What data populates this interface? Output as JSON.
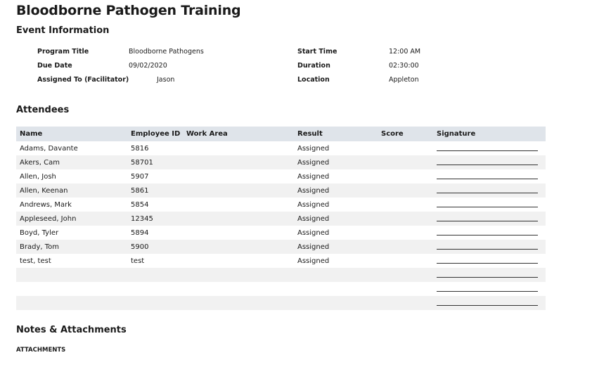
{
  "title": "Bloodborne Pathogen Training",
  "event_info": {
    "heading": "Event Information",
    "fields": [
      {
        "label": "Program Title",
        "value": "Bloodborne Pathogens"
      },
      {
        "label": "Due Date",
        "value": "09/02/2020"
      },
      {
        "label": "Assigned To (Facilitator)",
        "value": "Jason"
      },
      {
        "label": "Start Time",
        "value": "12:00 AM"
      },
      {
        "label": "Duration",
        "value": "02:30:00"
      },
      {
        "label": "Location",
        "value": "Appleton"
      }
    ]
  },
  "attendees": {
    "heading": "Attendees",
    "columns": [
      "Name",
      "Employee ID",
      "Work Area",
      "Result",
      "Score",
      "Signature"
    ],
    "rows": [
      {
        "name": "Adams, Davante",
        "employee_id": "5816",
        "work_area": "",
        "result": "Assigned",
        "score": ""
      },
      {
        "name": "Akers, Cam",
        "employee_id": "58701",
        "work_area": "",
        "result": "Assigned",
        "score": ""
      },
      {
        "name": "Allen, Josh",
        "employee_id": "5907",
        "work_area": "",
        "result": "Assigned",
        "score": ""
      },
      {
        "name": "Allen, Keenan",
        "employee_id": "5861",
        "work_area": "",
        "result": "Assigned",
        "score": ""
      },
      {
        "name": "Andrews, Mark",
        "employee_id": "5854",
        "work_area": "",
        "result": "Assigned",
        "score": ""
      },
      {
        "name": "Appleseed, John",
        "employee_id": "12345",
        "work_area": "",
        "result": "Assigned",
        "score": ""
      },
      {
        "name": "Boyd, Tyler",
        "employee_id": "5894",
        "work_area": "",
        "result": "Assigned",
        "score": ""
      },
      {
        "name": "Brady, Tom",
        "employee_id": "5900",
        "work_area": "",
        "result": "Assigned",
        "score": ""
      },
      {
        "name": "test, test",
        "employee_id": "test",
        "work_area": "",
        "result": "Assigned",
        "score": ""
      },
      {
        "name": "",
        "employee_id": "",
        "work_area": "",
        "result": "",
        "score": ""
      },
      {
        "name": "",
        "employee_id": "",
        "work_area": "",
        "result": "",
        "score": ""
      },
      {
        "name": "",
        "employee_id": "",
        "work_area": "",
        "result": "",
        "score": ""
      }
    ]
  },
  "notes": {
    "heading": "Notes & Attachments",
    "attachments_label": "ATTACHMENTS"
  },
  "colors": {
    "header_bg": "#dfe4ea",
    "stripe_bg": "#f1f1f1"
  }
}
